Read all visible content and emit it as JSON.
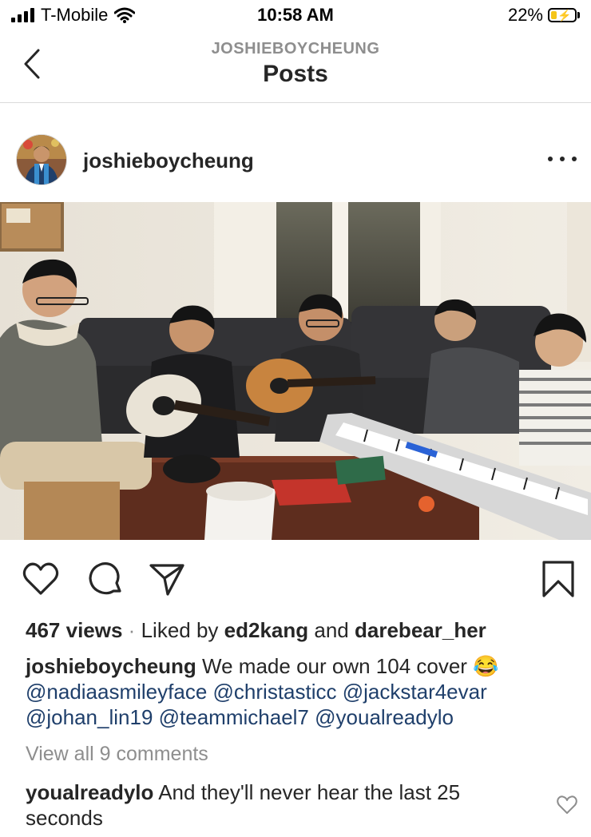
{
  "status_bar": {
    "carrier": "T-Mobile",
    "time": "10:58 AM",
    "battery": "22%",
    "battery_level": 0.22,
    "icons": [
      "signal-icon",
      "wifi-icon",
      "battery-icon"
    ]
  },
  "nav": {
    "subtitle": "JOSHIEBOYCHEUNG",
    "title": "Posts",
    "back_icon": "chevron-left-icon"
  },
  "post": {
    "username": "joshieboycheung",
    "more_icon": "more-horizontal-icon",
    "action_icons": [
      "heart-icon",
      "comment-icon",
      "share-icon",
      "bookmark-icon"
    ],
    "views": "467 views",
    "separator": "·",
    "liked_by_prefix": "Liked by",
    "liked_user_1": "ed2kang",
    "liked_and": "and",
    "liked_user_2": "darebear_her",
    "caption_user": "joshieboycheung",
    "caption_text": "We made our own 104 cover 😂",
    "mentions": [
      "@nadiaasmileyface",
      "@christasticc",
      "@jackstar4evar",
      "@johan_lin19",
      "@teammichael7",
      "@youalreadylo"
    ],
    "view_all_comments": "View all 9 comments",
    "comment_user": "youalreadylo",
    "comment_text": "And they'll never hear the last 25 seconds"
  }
}
